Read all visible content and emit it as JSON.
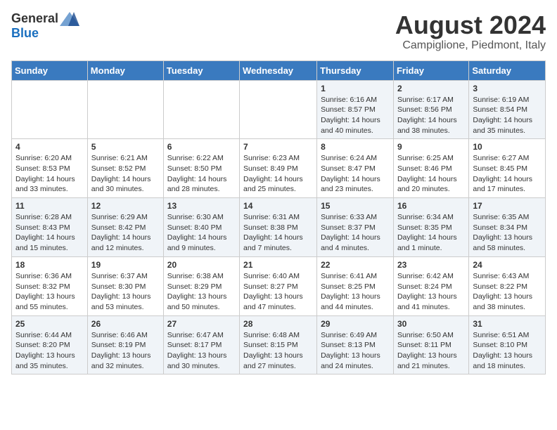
{
  "logo": {
    "general": "General",
    "blue": "Blue"
  },
  "title": "August 2024",
  "location": "Campiglione, Piedmont, Italy",
  "days_header": [
    "Sunday",
    "Monday",
    "Tuesday",
    "Wednesday",
    "Thursday",
    "Friday",
    "Saturday"
  ],
  "weeks": [
    [
      {
        "day": "",
        "info": ""
      },
      {
        "day": "",
        "info": ""
      },
      {
        "day": "",
        "info": ""
      },
      {
        "day": "",
        "info": ""
      },
      {
        "day": "1",
        "info": "Sunrise: 6:16 AM\nSunset: 8:57 PM\nDaylight: 14 hours and 40 minutes."
      },
      {
        "day": "2",
        "info": "Sunrise: 6:17 AM\nSunset: 8:56 PM\nDaylight: 14 hours and 38 minutes."
      },
      {
        "day": "3",
        "info": "Sunrise: 6:19 AM\nSunset: 8:54 PM\nDaylight: 14 hours and 35 minutes."
      }
    ],
    [
      {
        "day": "4",
        "info": "Sunrise: 6:20 AM\nSunset: 8:53 PM\nDaylight: 14 hours and 33 minutes."
      },
      {
        "day": "5",
        "info": "Sunrise: 6:21 AM\nSunset: 8:52 PM\nDaylight: 14 hours and 30 minutes."
      },
      {
        "day": "6",
        "info": "Sunrise: 6:22 AM\nSunset: 8:50 PM\nDaylight: 14 hours and 28 minutes."
      },
      {
        "day": "7",
        "info": "Sunrise: 6:23 AM\nSunset: 8:49 PM\nDaylight: 14 hours and 25 minutes."
      },
      {
        "day": "8",
        "info": "Sunrise: 6:24 AM\nSunset: 8:47 PM\nDaylight: 14 hours and 23 minutes."
      },
      {
        "day": "9",
        "info": "Sunrise: 6:25 AM\nSunset: 8:46 PM\nDaylight: 14 hours and 20 minutes."
      },
      {
        "day": "10",
        "info": "Sunrise: 6:27 AM\nSunset: 8:45 PM\nDaylight: 14 hours and 17 minutes."
      }
    ],
    [
      {
        "day": "11",
        "info": "Sunrise: 6:28 AM\nSunset: 8:43 PM\nDaylight: 14 hours and 15 minutes."
      },
      {
        "day": "12",
        "info": "Sunrise: 6:29 AM\nSunset: 8:42 PM\nDaylight: 14 hours and 12 minutes."
      },
      {
        "day": "13",
        "info": "Sunrise: 6:30 AM\nSunset: 8:40 PM\nDaylight: 14 hours and 9 minutes."
      },
      {
        "day": "14",
        "info": "Sunrise: 6:31 AM\nSunset: 8:38 PM\nDaylight: 14 hours and 7 minutes."
      },
      {
        "day": "15",
        "info": "Sunrise: 6:33 AM\nSunset: 8:37 PM\nDaylight: 14 hours and 4 minutes."
      },
      {
        "day": "16",
        "info": "Sunrise: 6:34 AM\nSunset: 8:35 PM\nDaylight: 14 hours and 1 minute."
      },
      {
        "day": "17",
        "info": "Sunrise: 6:35 AM\nSunset: 8:34 PM\nDaylight: 13 hours and 58 minutes."
      }
    ],
    [
      {
        "day": "18",
        "info": "Sunrise: 6:36 AM\nSunset: 8:32 PM\nDaylight: 13 hours and 55 minutes."
      },
      {
        "day": "19",
        "info": "Sunrise: 6:37 AM\nSunset: 8:30 PM\nDaylight: 13 hours and 53 minutes."
      },
      {
        "day": "20",
        "info": "Sunrise: 6:38 AM\nSunset: 8:29 PM\nDaylight: 13 hours and 50 minutes."
      },
      {
        "day": "21",
        "info": "Sunrise: 6:40 AM\nSunset: 8:27 PM\nDaylight: 13 hours and 47 minutes."
      },
      {
        "day": "22",
        "info": "Sunrise: 6:41 AM\nSunset: 8:25 PM\nDaylight: 13 hours and 44 minutes."
      },
      {
        "day": "23",
        "info": "Sunrise: 6:42 AM\nSunset: 8:24 PM\nDaylight: 13 hours and 41 minutes."
      },
      {
        "day": "24",
        "info": "Sunrise: 6:43 AM\nSunset: 8:22 PM\nDaylight: 13 hours and 38 minutes."
      }
    ],
    [
      {
        "day": "25",
        "info": "Sunrise: 6:44 AM\nSunset: 8:20 PM\nDaylight: 13 hours and 35 minutes."
      },
      {
        "day": "26",
        "info": "Sunrise: 6:46 AM\nSunset: 8:19 PM\nDaylight: 13 hours and 32 minutes."
      },
      {
        "day": "27",
        "info": "Sunrise: 6:47 AM\nSunset: 8:17 PM\nDaylight: 13 hours and 30 minutes."
      },
      {
        "day": "28",
        "info": "Sunrise: 6:48 AM\nSunset: 8:15 PM\nDaylight: 13 hours and 27 minutes."
      },
      {
        "day": "29",
        "info": "Sunrise: 6:49 AM\nSunset: 8:13 PM\nDaylight: 13 hours and 24 minutes."
      },
      {
        "day": "30",
        "info": "Sunrise: 6:50 AM\nSunset: 8:11 PM\nDaylight: 13 hours and 21 minutes."
      },
      {
        "day": "31",
        "info": "Sunrise: 6:51 AM\nSunset: 8:10 PM\nDaylight: 13 hours and 18 minutes."
      }
    ]
  ]
}
